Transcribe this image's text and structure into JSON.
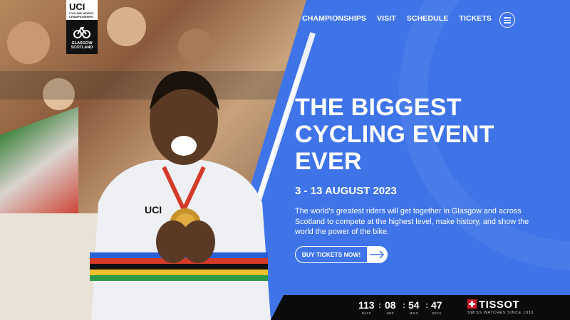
{
  "brand": {
    "uci_logo": "UCI",
    "uci_subtitle": "CYCLING WORLD CHAMPIONSHIPS",
    "glasgow_logo": "GLASGOW SCOTLAND"
  },
  "nav": {
    "items": [
      "CHAMPIONSHIPS",
      "VISIT",
      "SCHEDULE",
      "TICKETS"
    ],
    "menu_icon": "hamburger-icon"
  },
  "hero": {
    "headline": "THE BIGGEST CYCLING EVENT EVER",
    "dates": "3 - 13 AUGUST 2023",
    "description": "The world's greatest riders will get together in Glasgow and across Scotland to compete at the highest level, make history, and show the world the power of the bike.",
    "cta_label": "BUY TICKETS NOW!",
    "cta_icon": "arrow-right-icon"
  },
  "countdown": {
    "days": "113",
    "days_label": "DAYS",
    "hrs": "08",
    "hrs_label": "HRS",
    "mins": "54",
    "mins_label": "MINS",
    "secs": "47",
    "secs_label": "SECS"
  },
  "sponsor": {
    "name": "TISSOT",
    "tagline": "SWISS WATCHES SINCE 1853"
  },
  "colors": {
    "brand_blue": "#3f74e8",
    "footer": "#0b0b0b",
    "tissot_red": "#d4172a"
  }
}
